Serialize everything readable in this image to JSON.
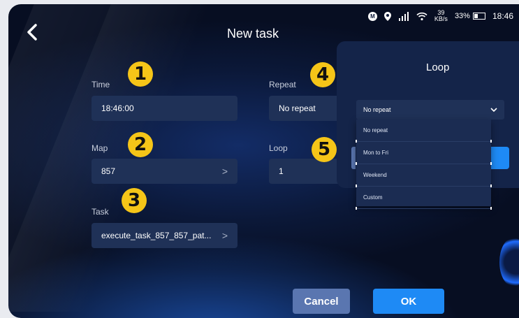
{
  "title": "New task",
  "status": {
    "speed_value": "39",
    "speed_unit": "KB/s",
    "battery": "33%",
    "time": "18:46"
  },
  "form": {
    "time_label": "Time",
    "time_value": "18:46:00",
    "map_label": "Map",
    "map_value": "857",
    "task_label": "Task",
    "task_value": "execute_task_857_857_pat...",
    "repeat_label": "Repeat",
    "repeat_value": "No repeat",
    "loop_label": "Loop",
    "loop_value": "1"
  },
  "badges": [
    "1",
    "2",
    "3",
    "4",
    "5"
  ],
  "loop_panel": {
    "title": "Loop",
    "selected": "No repeat",
    "options": [
      "No repeat",
      "Mon to Fri",
      "Weekend",
      "Custom"
    ]
  },
  "buttons": {
    "cancel": "Cancel",
    "ok": "OK"
  },
  "icons": [
    "back-icon",
    "m-circle-icon",
    "location-pin-icon",
    "signal-icon",
    "wifi-icon",
    "battery-icon",
    "chevron-right-icon",
    "chevron-down-icon"
  ]
}
